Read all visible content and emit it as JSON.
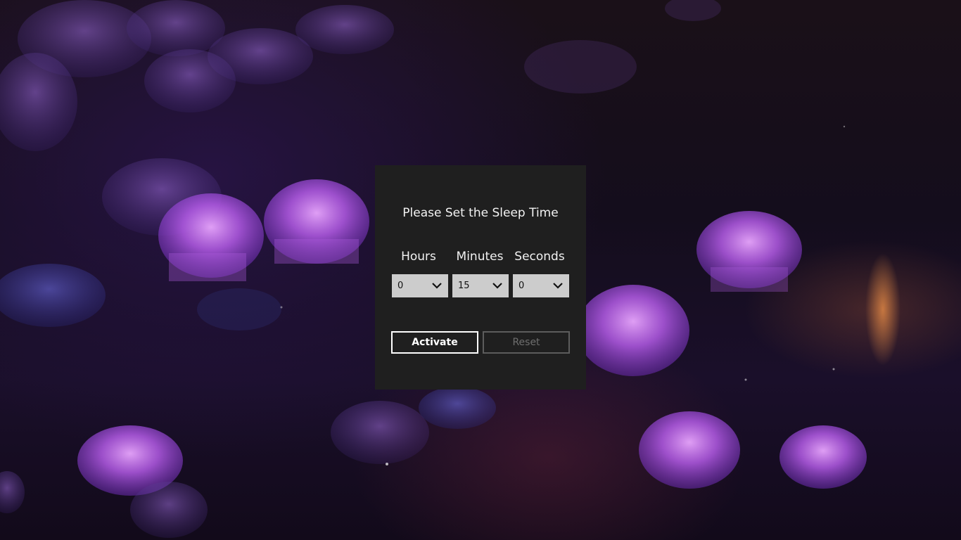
{
  "dialog": {
    "title": "Please Set the Sleep Time",
    "columns": {
      "hours": {
        "label": "Hours",
        "selected": "0"
      },
      "minutes": {
        "label": "Minutes",
        "selected": "15"
      },
      "seconds": {
        "label": "Seconds",
        "selected": "0"
      }
    },
    "buttons": {
      "activate": "Activate",
      "reset": "Reset"
    }
  },
  "icons": {
    "dropdown": "chevron-down-icon"
  },
  "colors": {
    "dialog_bg": "#1f1f1f",
    "select_bg": "#cccccc",
    "text": "#f2f2f2",
    "reset_disabled": "#6e6e6e"
  }
}
